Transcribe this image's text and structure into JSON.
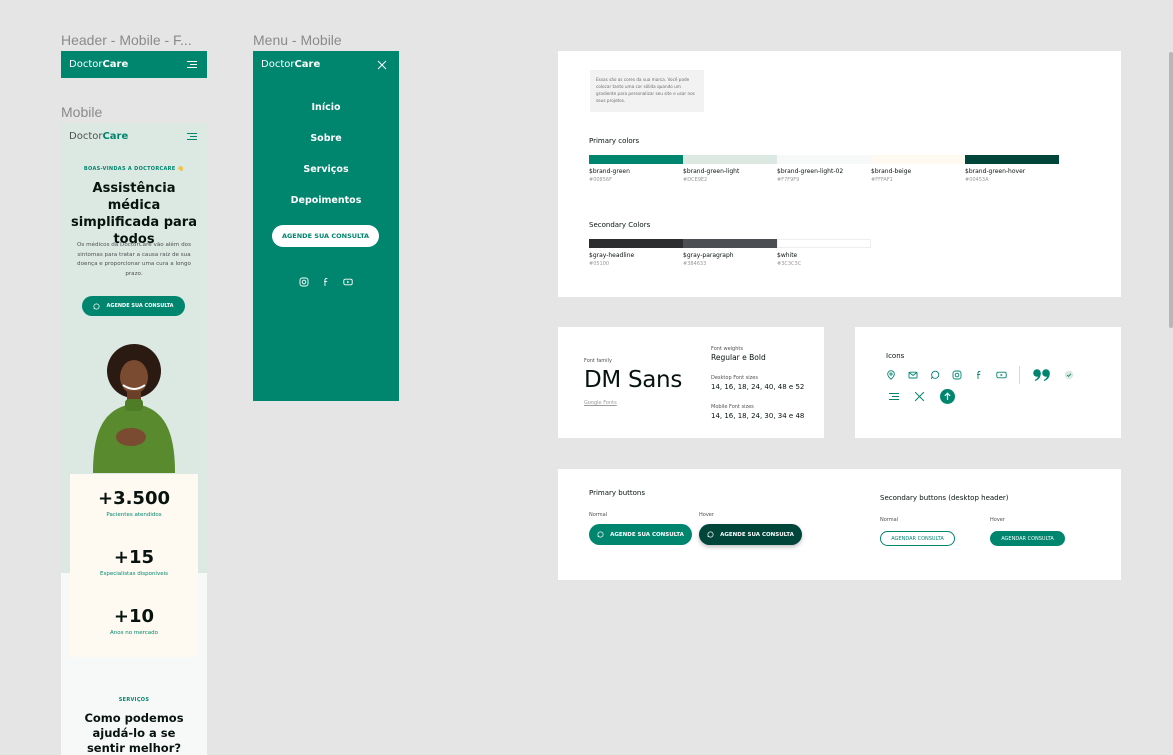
{
  "labels": {
    "header_frame": "Header - Mobile - F...",
    "menu_frame": "Menu - Mobile",
    "mobile_frame": "Mobile"
  },
  "brand": {
    "logo_light": "Doctor",
    "logo_bold": "Care"
  },
  "menu": {
    "items": [
      "Início",
      "Sobre",
      "Serviços",
      "Depoimentos"
    ],
    "cta": "AGENDE SUA CONSULTA"
  },
  "mobile": {
    "eyebrow": "BOAS-VINDAS A DOCTORCARE 👋",
    "title": "Assistência médica simplificada para todos",
    "description": "Os médicos da DoctorCare vão além dos sintomas para tratar a causa raiz de sua doença e proporcionar uma cura a longo prazo.",
    "cta": "AGENDE SUA CONSULTA",
    "stats": [
      {
        "value": "+3.500",
        "label": "Pacientes atendidos"
      },
      {
        "value": "+15",
        "label": "Especialistas disponíveis"
      },
      {
        "value": "+10",
        "label": "Anos no mercado"
      }
    ],
    "services_eyebrow": "SERVIÇOS",
    "services_title": "Como podemos ajudá-lo a se sentir melhor?"
  },
  "colors_card": {
    "note": "Essas são as cores da sua marca. Você pode colocar tanto uma cor sólida quando um gradiente para personalizar seu site e usar nos seus projetos.",
    "primary_title": "Primary colors",
    "primary": [
      {
        "name": "$brand-green",
        "hex": "#00856F",
        "color": "#00856f"
      },
      {
        "name": "$brand-green-light",
        "hex": "#DCE9E2",
        "color": "#dce9e2"
      },
      {
        "name": "$brand-green-light-02",
        "hex": "#F7F9F9",
        "color": "#f7f9f9"
      },
      {
        "name": "$brand-beige",
        "hex": "#FFFAF1",
        "color": "#fffaf1"
      },
      {
        "name": "$brand-green-hover",
        "hex": "#00453A",
        "color": "#00453a"
      }
    ],
    "secondary_title": "Secondary Colors",
    "secondary": [
      {
        "name": "$gray-headline",
        "hex": "#05100",
        "color": "#2b2d2f"
      },
      {
        "name": "$gray-paragraph",
        "hex": "#384633",
        "color": "#4b4e52"
      },
      {
        "name": "$white",
        "hex": "#3C3C3C",
        "color": "#ffffff"
      }
    ]
  },
  "font_card": {
    "family_label": "Font family",
    "family": "DM Sans",
    "link": "Google Fonts",
    "weights_label": "Font weights",
    "weights": "Regular e Bold",
    "desktop_label": "Desktop Font sizes",
    "desktop_sizes": "14, 16, 18, 24, 40, 48 e 52",
    "mobile_label": "Mobile Font sizes",
    "mobile_sizes": "14, 16, 18, 24, 30, 34 e 48"
  },
  "icons_card": {
    "title": "Icons"
  },
  "buttons_card": {
    "primary_title": "Primary buttons",
    "normal_label": "Normal",
    "hover_label": "Hover",
    "primary_btn": "AGENDE SUA CONSULTA",
    "secondary_title": "Secondary buttons (desktop header)",
    "secondary_btn": "AGENDAR CONSULTA"
  }
}
